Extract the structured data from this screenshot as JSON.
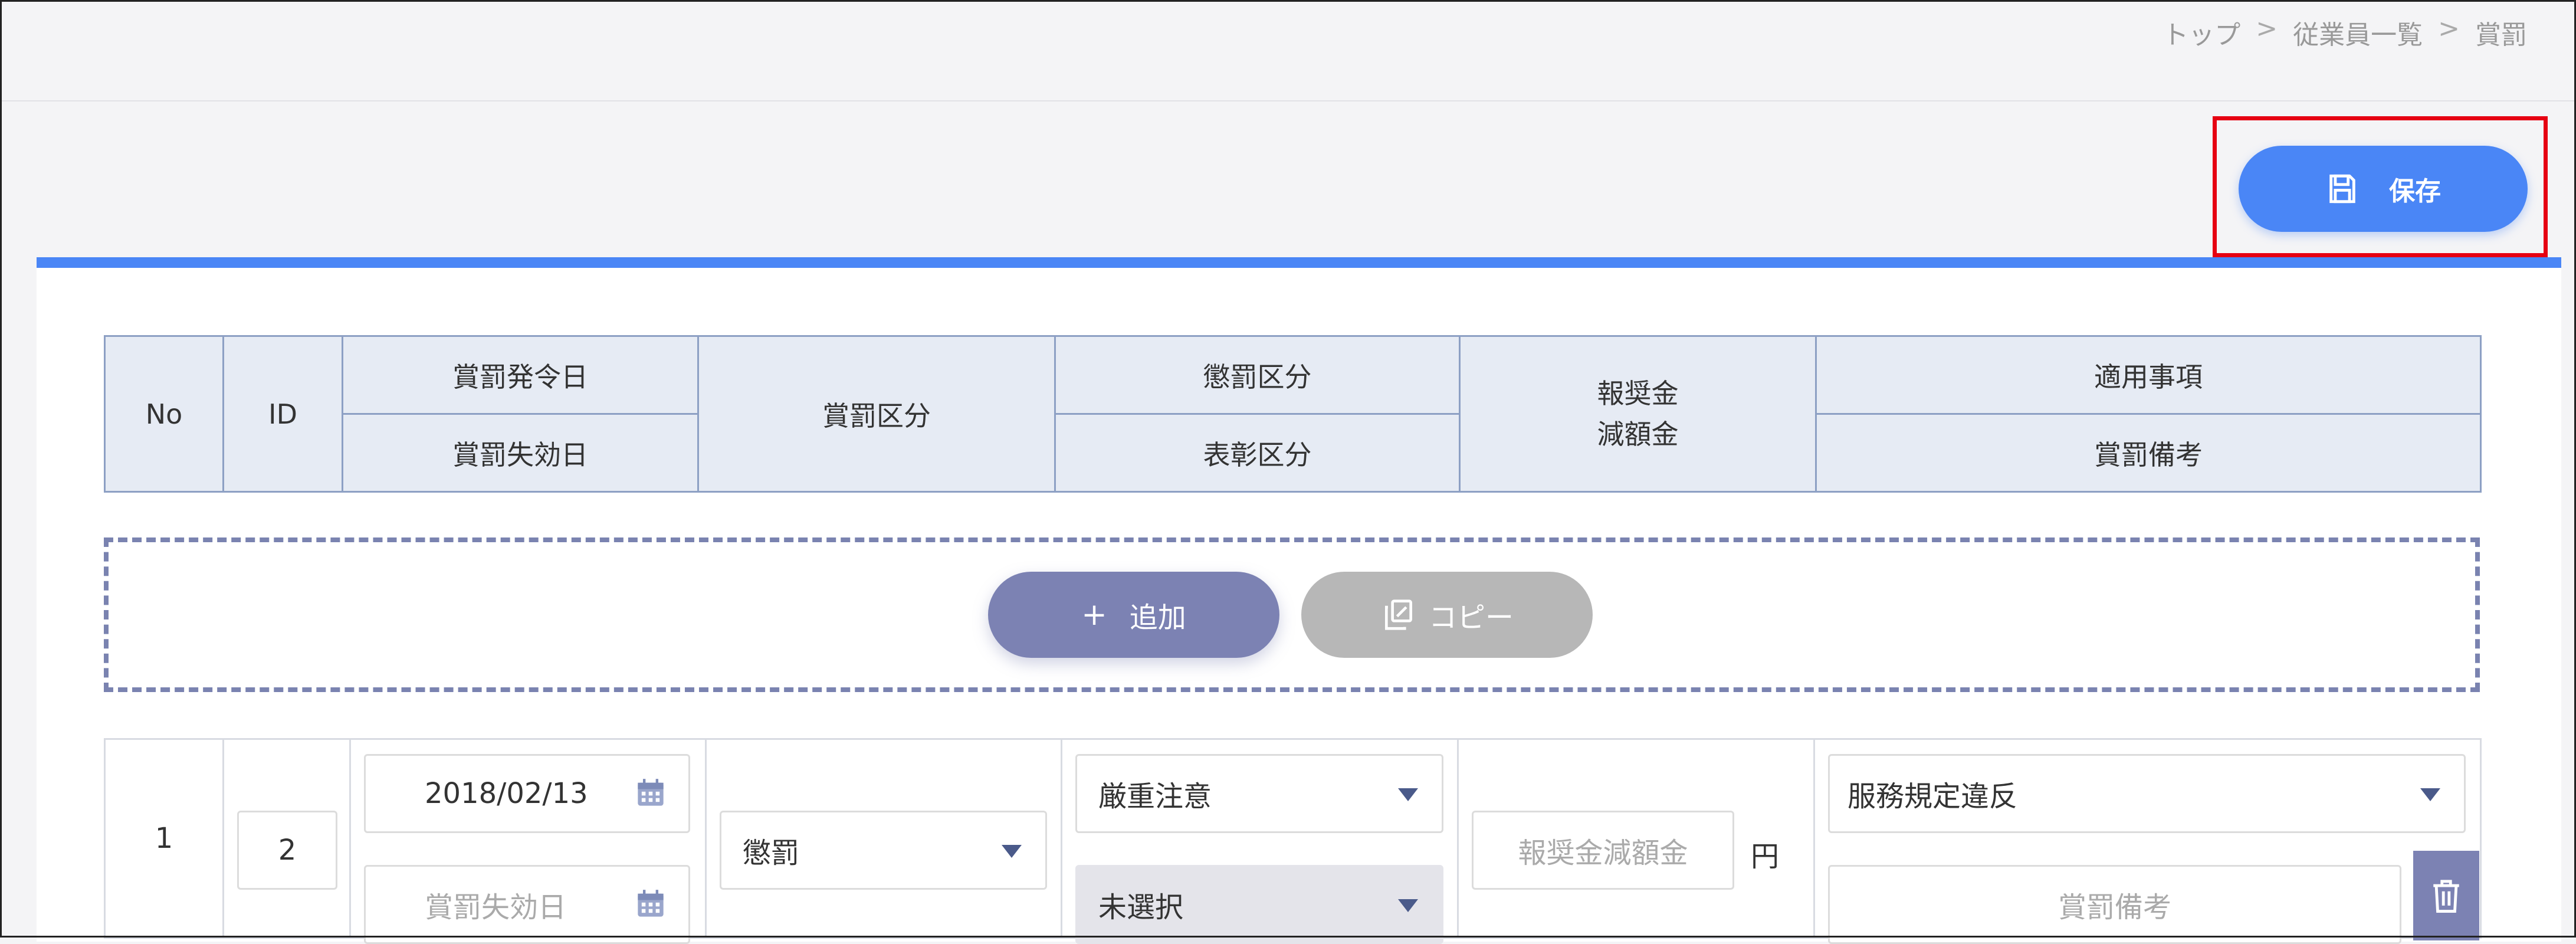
{
  "breadcrumb": {
    "items": [
      "トップ",
      "従業員一覧",
      "賞罰"
    ],
    "separator": ">"
  },
  "toolbar": {
    "save_label": "保存"
  },
  "header": {
    "no": "No",
    "id": "ID",
    "issue_date": "賞罰発令日",
    "expiry_date": "賞罰失効日",
    "category": "賞罰区分",
    "punishment_category": "懲罰区分",
    "commendation_category": "表彰区分",
    "reward_line1": "報奨金",
    "reward_line2": "減額金",
    "applicable": "適用事項",
    "remarks": "賞罰備考"
  },
  "actions": {
    "add_label": "追加",
    "copy_label": "コピー"
  },
  "row": {
    "no": "1",
    "id": "2",
    "issue_date": "2018/02/13",
    "expiry_placeholder": "賞罰失効日",
    "category": "懲罰",
    "punishment": "厳重注意",
    "commendation": "未選択",
    "amount_placeholder": "報奨金減額金",
    "currency": "円",
    "applicable": "服務規定違反",
    "remarks_placeholder": "賞罰備考"
  },
  "colors": {
    "accent": "#4a86f6",
    "add_button": "#7c82b3",
    "copy_button": "#b7b7b7",
    "highlight": "#e60012",
    "header_bg": "#e6ebf4"
  }
}
